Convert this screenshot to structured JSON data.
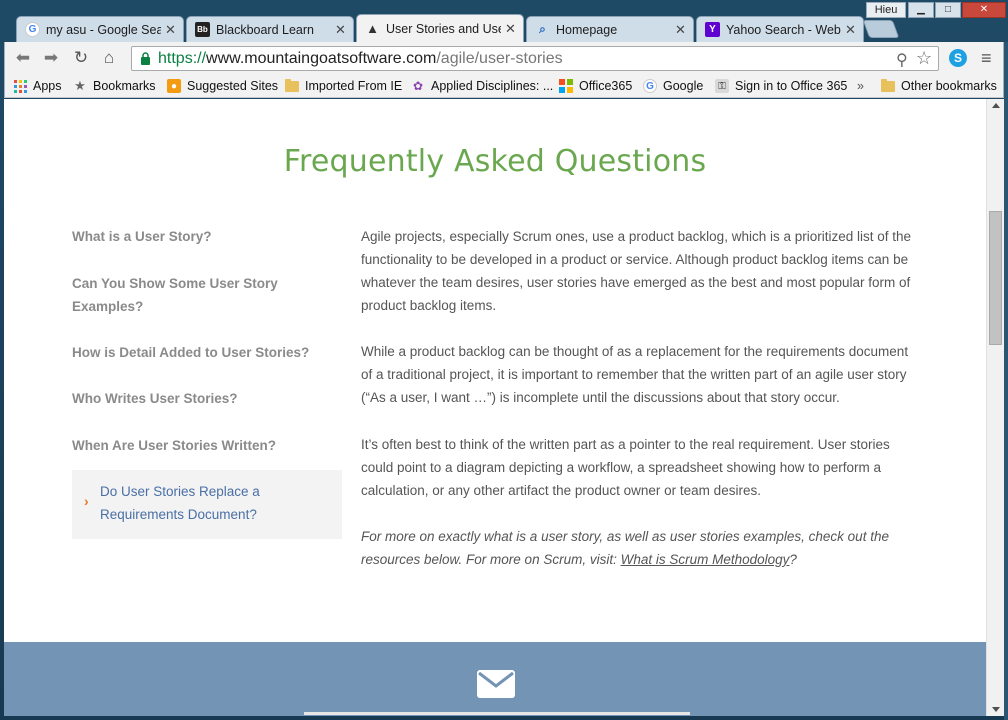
{
  "window": {
    "user_label": "Hieu",
    "tabs": [
      {
        "title": "my asu - Google Sear",
        "icon": "google-icon"
      },
      {
        "title": "Blackboard Learn",
        "icon": "blackboard-icon",
        "icon_text": "Bb"
      },
      {
        "title": "Stories and User",
        "icon": "mountain-goat-icon",
        "prefix": "User "
      },
      {
        "title": "Homepage",
        "icon": "search-tab-icon"
      },
      {
        "title": "Yahoo Search - Web S",
        "icon": "yahoo-icon",
        "icon_text": "Y"
      }
    ],
    "active_tab_full": "User Stories and User"
  },
  "toolbar": {
    "url_scheme": "https://",
    "url_host": "www.mountaingoatsoftware.com",
    "url_path": "/agile/user-stories",
    "skype_label": "S"
  },
  "bookmarks": [
    {
      "label": "Apps",
      "icon": "apps-grid-icon"
    },
    {
      "label": "Bookmarks",
      "icon": "star-icon"
    },
    {
      "label": "Suggested Sites",
      "icon": "suggested-sites-icon"
    },
    {
      "label": "Imported From IE",
      "icon": "folder-icon"
    },
    {
      "label": "Applied Disciplines: ...",
      "icon": "applied-disciplines-icon"
    },
    {
      "label": "Office365",
      "icon": "office-icon"
    },
    {
      "label": "Google",
      "icon": "google-icon"
    },
    {
      "label": "Sign in to Office 365",
      "icon": "office-signin-icon"
    },
    {
      "label": "»",
      "icon": "chevron-more-icon"
    },
    {
      "label": "Other bookmarks",
      "icon": "folder-icon"
    }
  ],
  "page": {
    "title": "Frequently Asked Questions",
    "questions": [
      "What is a User Story?",
      "Can You Show Some User Story Examples?",
      "How is Detail Added to User Stories?",
      "Who Writes User Stories?",
      "When Are User Stories Written?",
      "Do User Stories Replace a Requirements Document?"
    ],
    "answer": {
      "p1": "Agile projects, especially Scrum ones, use a product backlog, which is a prioritized list of the functionality to be developed in a product or service. Although product backlog items can be whatever the team desires, user stories have emerged as the best and most popular form of product backlog items.",
      "p2": "While a product backlog can be thought of as a replacement for the requirements document of a traditional project, it is important to remember that the written part of an agile user story (“As a user, I want …”) is incomplete until the discussions about that story occur.",
      "p3": "It’s often best to think of the written part as a pointer to the real requirement. User stories could point to a diagram depicting a workflow, a spreadsheet showing how to perform a calculation, or any other artifact the product owner or team desires.",
      "p4_text": "For more on exactly what is a user story, as well as user stories examples, check out the resources below. For more on Scrum, visit: ",
      "p4_link": "What is Scrum Methodology",
      "p4_end": "?"
    }
  },
  "colors": {
    "title_green": "#6aa84f",
    "active_link": "#4a6fa5",
    "chevron_orange": "#e8772e",
    "footer_blue": "#7494b5"
  }
}
